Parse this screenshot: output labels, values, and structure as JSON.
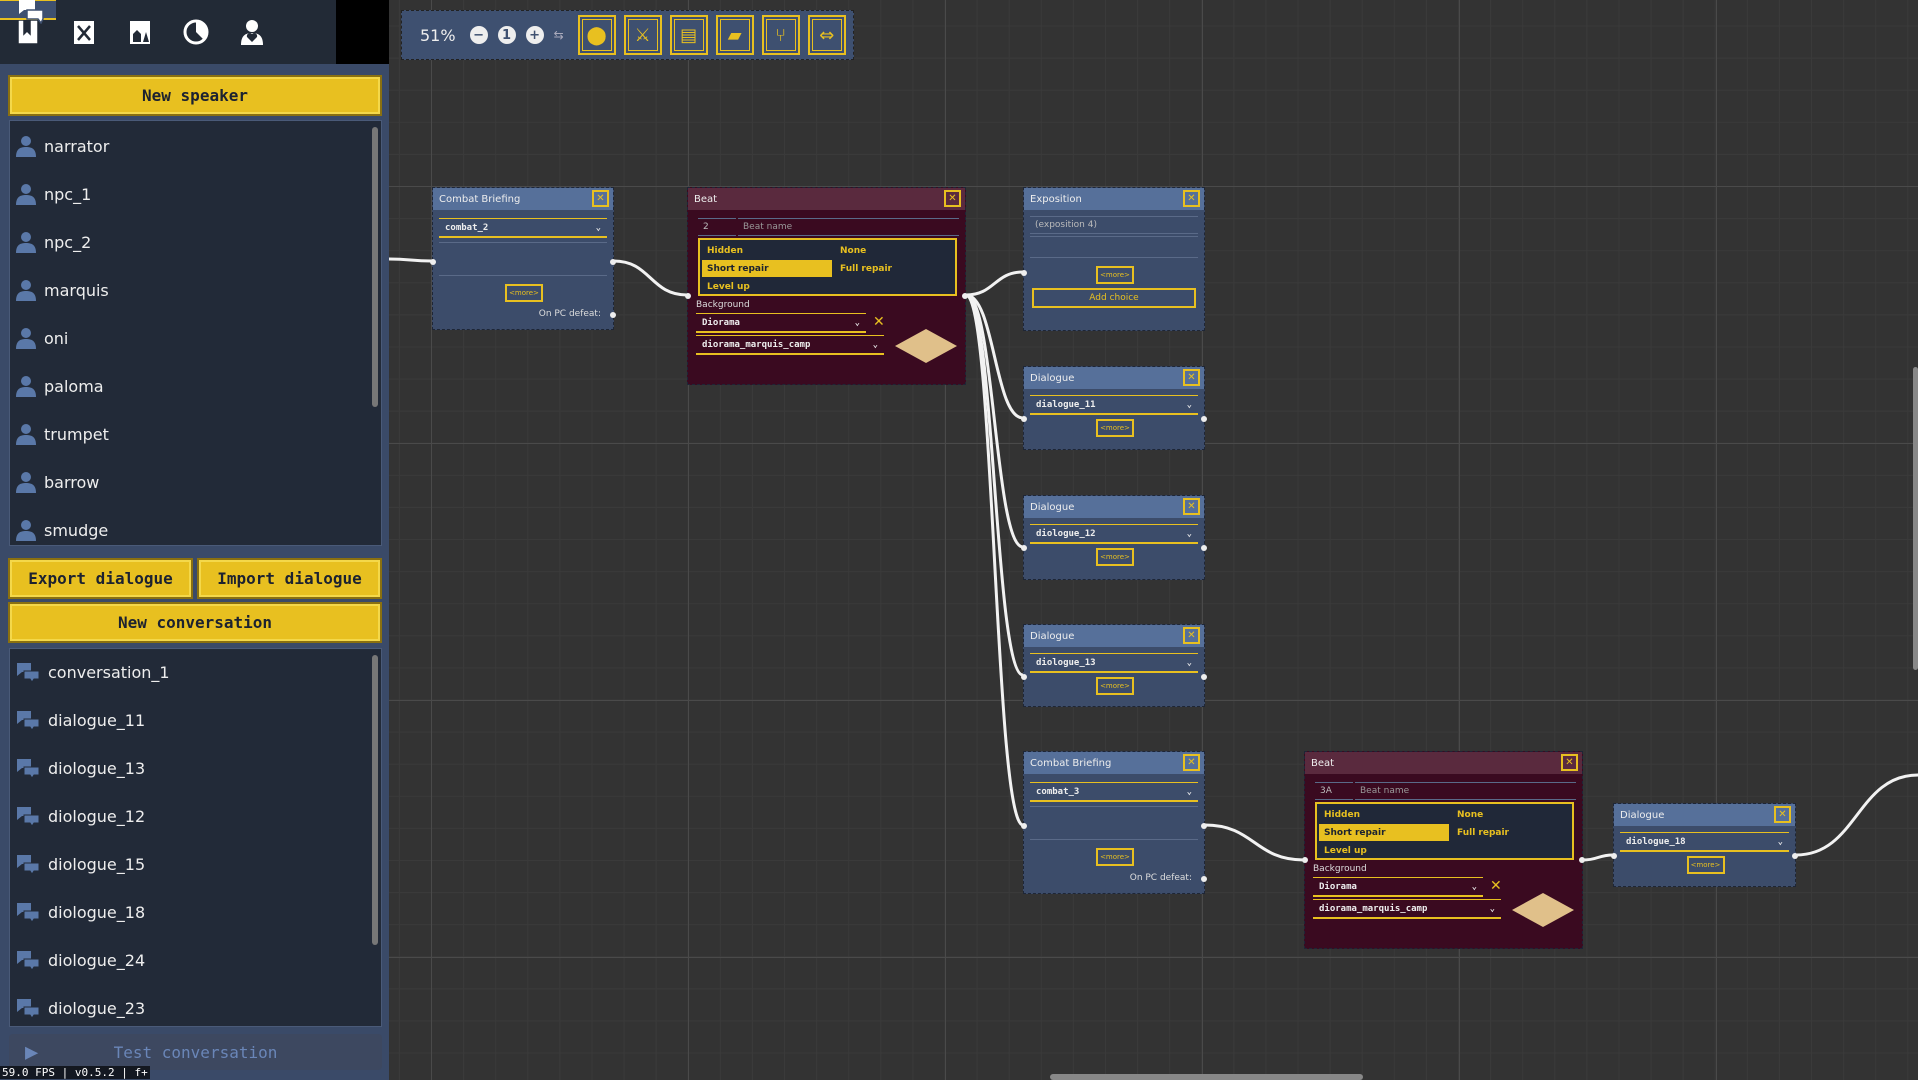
{
  "sidebar": {
    "tabs": [
      {
        "icon": "book-icon"
      },
      {
        "icon": "combat-icon"
      },
      {
        "icon": "scene-icon"
      },
      {
        "icon": "time-icon"
      },
      {
        "icon": "character-icon"
      },
      {
        "icon": "dialogue-icon",
        "selected": true
      }
    ],
    "new_speaker": "New speaker",
    "speakers": [
      "narrator",
      "npc_1",
      "npc_2",
      "marquis",
      "oni",
      "paloma",
      "trumpet",
      "barrow",
      "smudge"
    ],
    "export": "Export dialogue",
    "import": "Import dialogue",
    "new_conversation": "New conversation",
    "conversations": [
      "conversation_1",
      "dialogue_11",
      "diologue_13",
      "diologue_12",
      "diologue_15",
      "diologue_18",
      "diologue_24",
      "diologue_23"
    ],
    "test": "Test conversation",
    "status": "59.0 FPS | v0.5.2 | f+"
  },
  "toolbar": {
    "zoom": "51%",
    "zoom_out": "−",
    "zoom_reset": "1",
    "zoom_in": "+",
    "tools": [
      {
        "icon": "location-pin-icon"
      },
      {
        "icon": "crossed-swords-icon"
      },
      {
        "icon": "exposition-icon"
      },
      {
        "icon": "dialogue-icon"
      },
      {
        "icon": "branch-icon"
      },
      {
        "icon": "jump-icon"
      }
    ]
  },
  "colors": {
    "accent": "#e8c020",
    "node": "#3c4c6a",
    "node_header": "#56709a",
    "beat": "#3a0a20",
    "beat_header": "#5a2a3e"
  },
  "nodes": [
    {
      "type": "combat",
      "title": "Combat Briefing",
      "value": "combat_2",
      "more": "<more>",
      "defeat": "On PC defeat:"
    },
    {
      "type": "beat",
      "title": "Beat",
      "number": "2",
      "name_placeholder": "Beat name",
      "options": [
        "Hidden",
        "None",
        "Short repair",
        "Full repair",
        "Level up"
      ],
      "selected": "Short repair",
      "bg_label": "Background",
      "bg_type": "Diorama",
      "bg_value": "diorama_marquis_camp"
    },
    {
      "type": "exposition",
      "title": "Exposition",
      "text": "(exposition 4)",
      "more": "<more>",
      "add": "Add choice"
    },
    {
      "type": "dialogue",
      "title": "Dialogue",
      "value": "dialogue_11",
      "more": "<more>"
    },
    {
      "type": "dialogue",
      "title": "Dialogue",
      "value": "diologue_12",
      "more": "<more>"
    },
    {
      "type": "dialogue",
      "title": "Dialogue",
      "value": "diologue_13",
      "more": "<more>"
    },
    {
      "type": "combat",
      "title": "Combat Briefing",
      "value": "combat_3",
      "more": "<more>",
      "defeat": "On PC defeat:"
    },
    {
      "type": "beat",
      "title": "Beat",
      "number": "3A",
      "name_placeholder": "Beat name",
      "options": [
        "Hidden",
        "None",
        "Short repair",
        "Full repair",
        "Level up"
      ],
      "selected": "Short repair",
      "bg_label": "Background",
      "bg_type": "Diorama",
      "bg_value": "diorama_marquis_camp"
    },
    {
      "type": "dialogue",
      "title": "Dialogue",
      "value": "diologue_18",
      "more": "<more>"
    }
  ]
}
